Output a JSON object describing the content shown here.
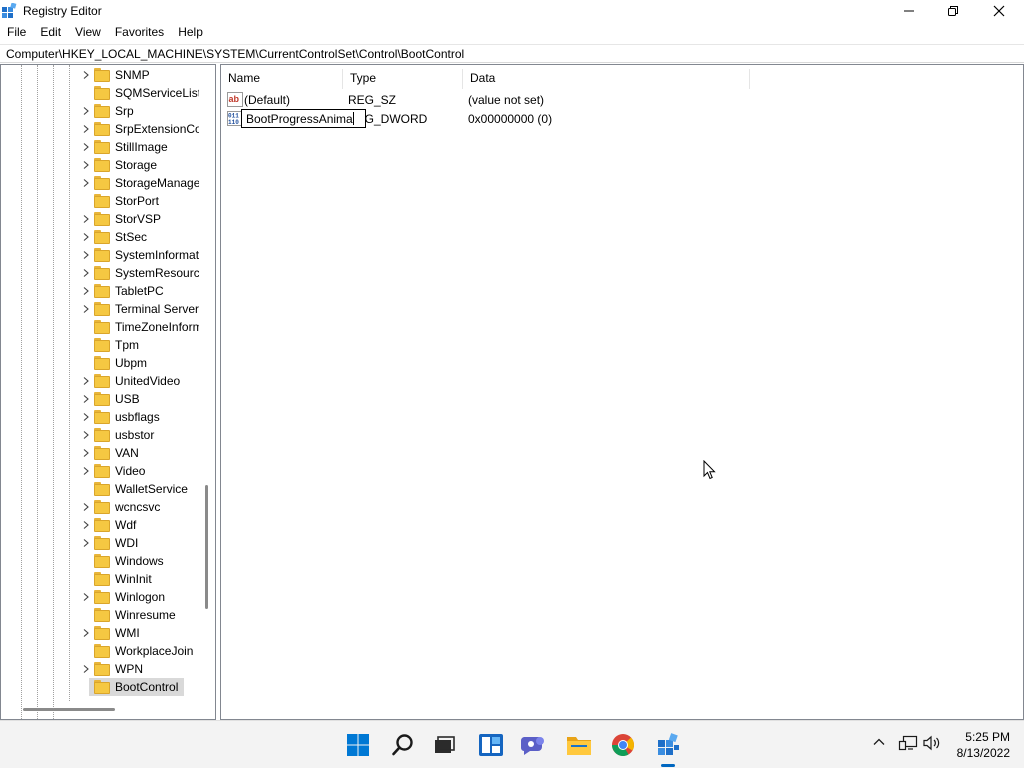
{
  "window": {
    "title": "Registry Editor"
  },
  "menu": [
    "File",
    "Edit",
    "View",
    "Favorites",
    "Help"
  ],
  "address": "Computer\\HKEY_LOCAL_MACHINE\\SYSTEM\\CurrentControlSet\\Control\\BootControl",
  "tree": {
    "items": [
      {
        "label": "SNMP",
        "expandable": true
      },
      {
        "label": "SQMServiceList",
        "expandable": false
      },
      {
        "label": "Srp",
        "expandable": true
      },
      {
        "label": "SrpExtensionConfig",
        "expandable": true
      },
      {
        "label": "StillImage",
        "expandable": true
      },
      {
        "label": "Storage",
        "expandable": true
      },
      {
        "label": "StorageManagement",
        "expandable": true
      },
      {
        "label": "StorPort",
        "expandable": false
      },
      {
        "label": "StorVSP",
        "expandable": true
      },
      {
        "label": "StSec",
        "expandable": true
      },
      {
        "label": "SystemInformation",
        "expandable": true
      },
      {
        "label": "SystemResources",
        "expandable": true
      },
      {
        "label": "TabletPC",
        "expandable": true
      },
      {
        "label": "Terminal Server",
        "expandable": true
      },
      {
        "label": "TimeZoneInformation",
        "expandable": false
      },
      {
        "label": "Tpm",
        "expandable": false
      },
      {
        "label": "Ubpm",
        "expandable": false
      },
      {
        "label": "UnitedVideo",
        "expandable": true
      },
      {
        "label": "USB",
        "expandable": true
      },
      {
        "label": "usbflags",
        "expandable": true
      },
      {
        "label": "usbstor",
        "expandable": true
      },
      {
        "label": "VAN",
        "expandable": true
      },
      {
        "label": "Video",
        "expandable": true
      },
      {
        "label": "WalletService",
        "expandable": false
      },
      {
        "label": "wcncsvc",
        "expandable": true
      },
      {
        "label": "Wdf",
        "expandable": true
      },
      {
        "label": "WDI",
        "expandable": true
      },
      {
        "label": "Windows",
        "expandable": false
      },
      {
        "label": "WinInit",
        "expandable": false
      },
      {
        "label": "Winlogon",
        "expandable": true
      },
      {
        "label": "Winresume",
        "expandable": false
      },
      {
        "label": "WMI",
        "expandable": true
      },
      {
        "label": "WorkplaceJoin",
        "expandable": false
      },
      {
        "label": "WPN",
        "expandable": true
      },
      {
        "label": "BootControl",
        "expandable": false,
        "selected": true
      }
    ]
  },
  "values": {
    "columns": [
      "Name",
      "Type",
      "Data"
    ],
    "rows": [
      {
        "name": "(Default)",
        "type": "REG_SZ",
        "data": "(value not set)",
        "icon": "string-value-icon"
      },
      {
        "name": "BootProgressAnima",
        "type": "REG_DWORD",
        "data": "0x00000000 (0)",
        "icon": "dword-value-icon",
        "editing": true
      }
    ]
  },
  "taskbar": {
    "icons": [
      "start-icon",
      "search-icon",
      "task-view-icon",
      "widgets-icon",
      "chat-icon",
      "file-explorer-icon",
      "chrome-icon",
      "registry-editor-icon"
    ],
    "time": "5:25 PM",
    "date": "8/13/2022"
  }
}
